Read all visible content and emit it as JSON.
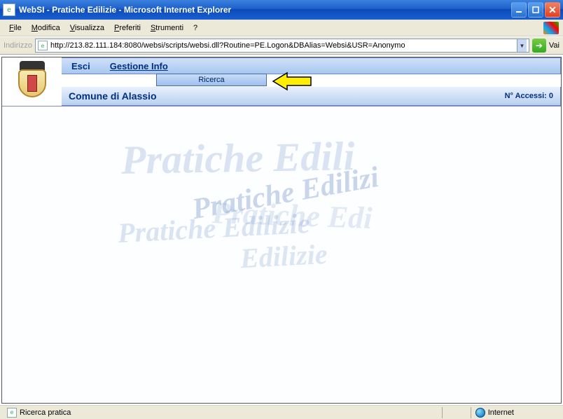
{
  "window": {
    "title": "WebSI - Pratiche Edilizie - Microsoft Internet Explorer"
  },
  "menubar": {
    "file": "File",
    "modifica": "Modifica",
    "visualizza": "Visualizza",
    "preferiti": "Preferiti",
    "strumenti": "Strumenti",
    "help": "?"
  },
  "address": {
    "label": "Indirizzo",
    "url": "http://213.82.111.184:8080/websi/scripts/websi.dll?Routine=PE.Logon&DBAlias=Websi&USR=Anonymo",
    "go": "Vai"
  },
  "app": {
    "menu": {
      "esci": "Esci",
      "gestione": "Gestione Info"
    },
    "submenu": {
      "ricerca": "Ricerca"
    },
    "site_title": "Comune di Alassio",
    "accessi": "N° Accessi: 0"
  },
  "watermark": {
    "t1": "Pratiche Edili",
    "t2": "Pratiche Edilizi",
    "t3": "Pratiche Edilizie",
    "t4": "Pratiche Edi",
    "t5": "Edilizie"
  },
  "status": {
    "left": "Ricerca pratica",
    "zone": "Internet"
  }
}
